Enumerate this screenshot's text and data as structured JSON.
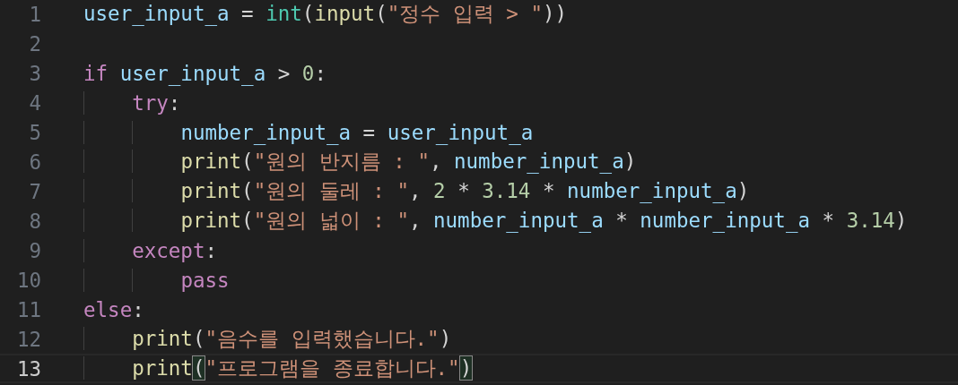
{
  "editor": {
    "lines": [
      {
        "number": "1",
        "current": false,
        "tokens": [
          {
            "kind": "var",
            "text": "user_input_a"
          },
          {
            "kind": "op",
            "text": " = "
          },
          {
            "kind": "class",
            "text": "int"
          },
          {
            "kind": "op",
            "text": "("
          },
          {
            "kind": "func",
            "text": "input"
          },
          {
            "kind": "op",
            "text": "("
          },
          {
            "kind": "str",
            "text": "\"정수 입력 > \""
          },
          {
            "kind": "op",
            "text": "))"
          }
        ]
      },
      {
        "number": "2",
        "current": false
      },
      {
        "number": "3",
        "current": false,
        "tokens": [
          {
            "kind": "kw",
            "text": "if"
          },
          {
            "kind": "var",
            "text": " user_input_a"
          },
          {
            "kind": "op",
            "text": " > "
          },
          {
            "kind": "num",
            "text": "0"
          },
          {
            "kind": "op",
            "text": ":"
          }
        ]
      },
      {
        "number": "4",
        "current": false,
        "tokens": [
          {
            "kind": "kw",
            "text": "    try"
          },
          {
            "kind": "op",
            "text": ":"
          }
        ]
      },
      {
        "number": "5",
        "current": false,
        "tokens": [
          {
            "kind": "var",
            "text": "        number_input_a"
          },
          {
            "kind": "op",
            "text": " = "
          },
          {
            "kind": "var",
            "text": "user_input_a"
          }
        ]
      },
      {
        "number": "6",
        "current": false,
        "tokens": [
          {
            "kind": "func",
            "text": "        print"
          },
          {
            "kind": "op",
            "text": "("
          },
          {
            "kind": "str",
            "text": "\"원의 반지름 : \""
          },
          {
            "kind": "op",
            "text": ", "
          },
          {
            "kind": "var",
            "text": "number_input_a"
          },
          {
            "kind": "op",
            "text": ")"
          }
        ]
      },
      {
        "number": "7",
        "current": false,
        "tokens": [
          {
            "kind": "func",
            "text": "        print"
          },
          {
            "kind": "op",
            "text": "("
          },
          {
            "kind": "str",
            "text": "\"원의 둘레 : \""
          },
          {
            "kind": "op",
            "text": ", "
          },
          {
            "kind": "num",
            "text": "2"
          },
          {
            "kind": "op",
            "text": " * "
          },
          {
            "kind": "num",
            "text": "3.14"
          },
          {
            "kind": "op",
            "text": " * "
          },
          {
            "kind": "var",
            "text": "number_input_a"
          },
          {
            "kind": "op",
            "text": ")"
          }
        ]
      },
      {
        "number": "8",
        "current": false,
        "tokens": [
          {
            "kind": "func",
            "text": "        print"
          },
          {
            "kind": "op",
            "text": "("
          },
          {
            "kind": "str",
            "text": "\"원의 넓이 : \""
          },
          {
            "kind": "op",
            "text": ", "
          },
          {
            "kind": "var",
            "text": "number_input_a"
          },
          {
            "kind": "op",
            "text": " * "
          },
          {
            "kind": "var",
            "text": "number_input_a"
          },
          {
            "kind": "op",
            "text": " * "
          },
          {
            "kind": "num",
            "text": "3.14"
          },
          {
            "kind": "op",
            "text": ")"
          }
        ]
      },
      {
        "number": "9",
        "current": false,
        "tokens": [
          {
            "kind": "kw",
            "text": "    except"
          },
          {
            "kind": "op",
            "text": ":"
          }
        ]
      },
      {
        "number": "10",
        "current": false,
        "tokens": [
          {
            "kind": "kw",
            "text": "        pass"
          }
        ]
      },
      {
        "number": "11",
        "current": false,
        "tokens": [
          {
            "kind": "kw",
            "text": "else"
          },
          {
            "kind": "op",
            "text": ":"
          }
        ]
      },
      {
        "number": "12",
        "current": false,
        "tokens": [
          {
            "kind": "func",
            "text": "    print"
          },
          {
            "kind": "op",
            "text": "("
          },
          {
            "kind": "str",
            "text": "\"음수를 입력했습니다.\""
          },
          {
            "kind": "op",
            "text": ")"
          }
        ]
      },
      {
        "number": "13",
        "current": true,
        "tokens": [
          {
            "kind": "func",
            "text": "    print"
          },
          {
            "kind": "bracket-match",
            "text": "("
          },
          {
            "kind": "str",
            "text": "\"프로그램을 종료합니다.\""
          },
          {
            "kind": "bracket-match",
            "text": ")"
          }
        ]
      }
    ]
  }
}
